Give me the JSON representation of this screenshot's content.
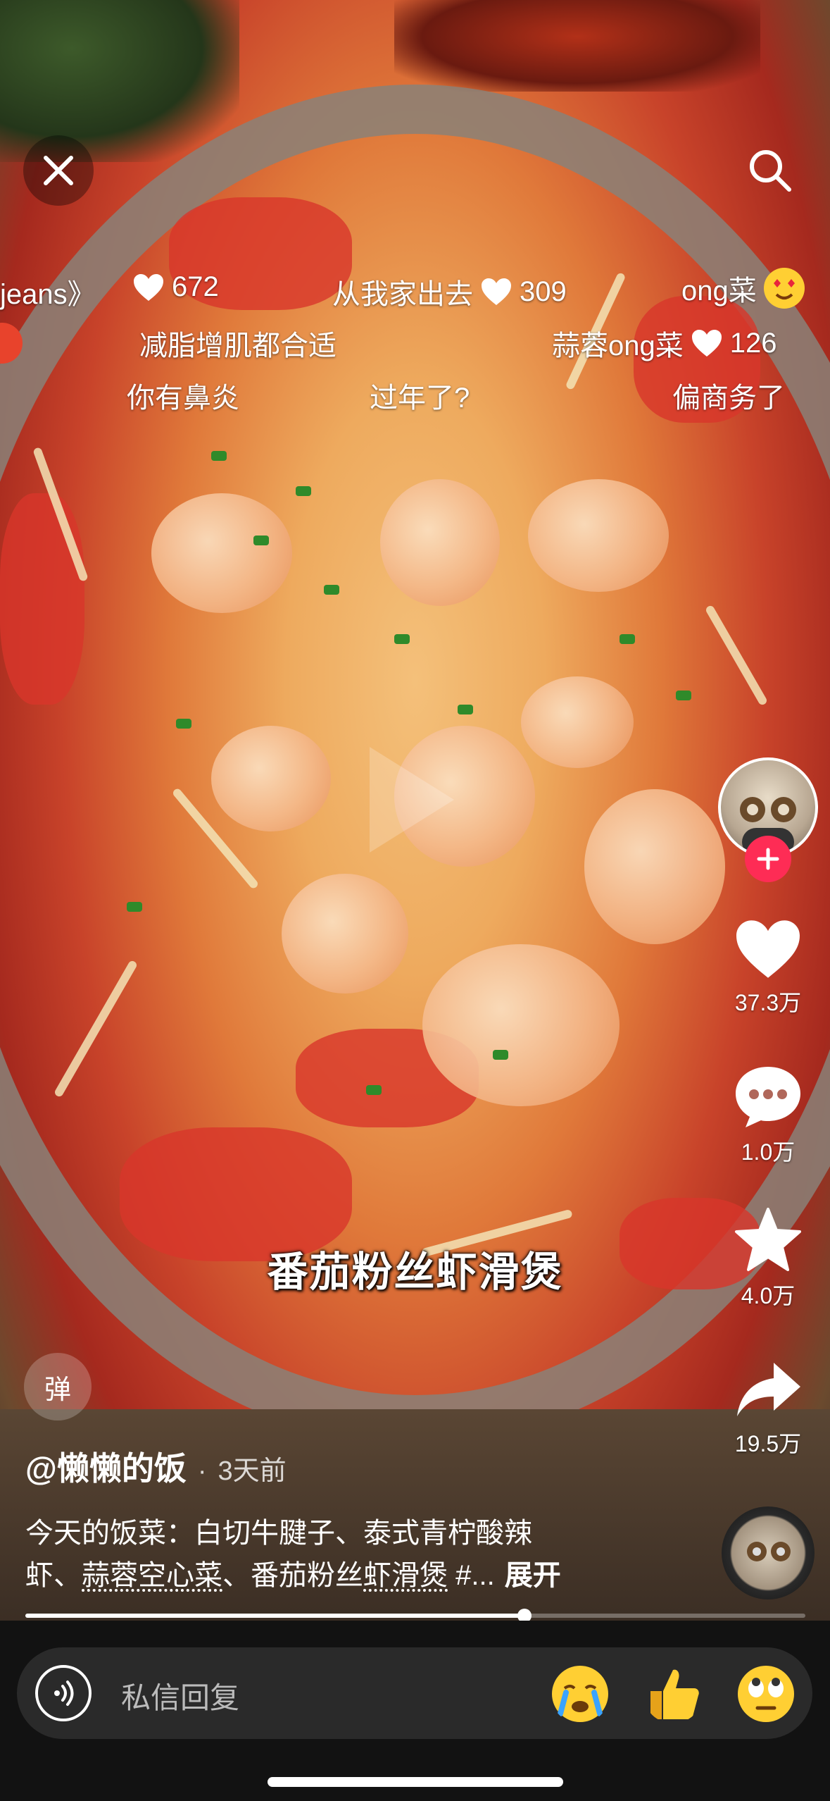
{
  "video": {
    "caption": "番茄粉丝虾滑煲"
  },
  "danmaku": [
    {
      "text": "jeans》",
      "likes": ""
    },
    {
      "text": "",
      "likes": "672"
    },
    {
      "text": "从我家出去",
      "likes": "309"
    },
    {
      "text": "ong菜",
      "likes": ""
    },
    {
      "text": "减脂增肌都合适",
      "likes": ""
    },
    {
      "text": "蒜蓉ong菜",
      "likes": "126"
    },
    {
      "text": "你有鼻炎",
      "likes": ""
    },
    {
      "text": "过年了?",
      "likes": ""
    },
    {
      "text": "偏商务了",
      "likes": ""
    }
  ],
  "rail": {
    "likes": "37.3万",
    "comments": "1.0万",
    "favorites": "4.0万",
    "shares": "19.5万"
  },
  "danmu_toggle_label": "弹",
  "author": "@懒懒的饭",
  "separator": "·",
  "timestamp": "3天前",
  "description": {
    "line1": "今天的饭菜：白切牛腱子、泰式青柠酸辣",
    "line2_pre": "虾、",
    "link1": "蒜蓉空心菜",
    "line2_mid": "、番茄粉丝",
    "link2": "虾滑煲",
    "line2_post": " #...",
    "more": "展开"
  },
  "progress": 0.64,
  "reply": {
    "placeholder": "私信回复"
  },
  "icons": {
    "close": "close-icon",
    "search": "search-icon",
    "heart": "heart-icon",
    "comment": "comment-icon",
    "star": "star-icon",
    "share": "share-icon",
    "voice": "voice-icon"
  },
  "colors": {
    "accent": "#fe2c55",
    "bar": "#121212"
  }
}
